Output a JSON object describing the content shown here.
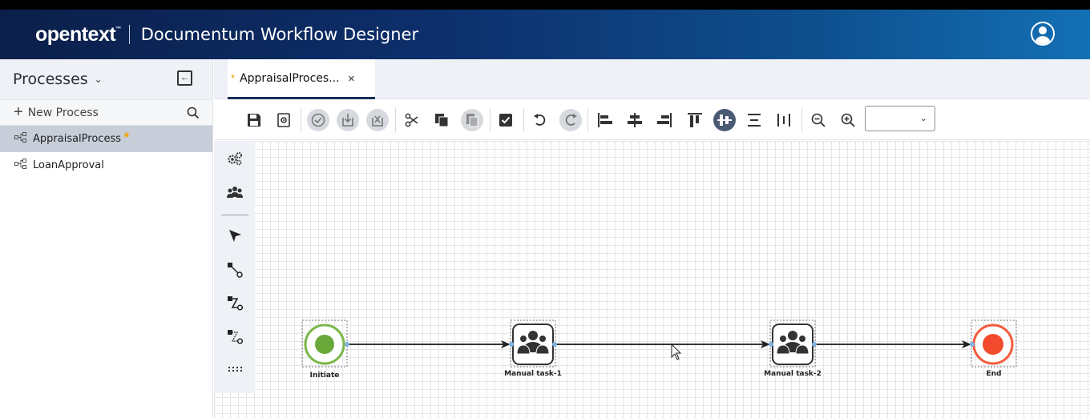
{
  "header": {
    "logo": "opentext",
    "logo_tm": "™",
    "app_title": "Documentum Workflow Designer"
  },
  "sidebar": {
    "title": "Processes",
    "new_process_label": "New Process",
    "items": [
      {
        "label": "AppraisalProcess",
        "active": true,
        "unsaved": true
      },
      {
        "label": "LoanApproval",
        "active": false,
        "unsaved": false
      }
    ]
  },
  "tabs": [
    {
      "label": "AppraisalProces...",
      "unsaved_marker": "*",
      "close": "×"
    }
  ],
  "toolbar": {
    "zoom_value": ""
  },
  "diagram": {
    "nodes": [
      {
        "id": "initiate",
        "label": "Initiate",
        "type": "start-event",
        "color": "#7ab648"
      },
      {
        "id": "manual1",
        "label": "Manual task-1",
        "type": "manual-task"
      },
      {
        "id": "manual2",
        "label": "Manual task-2",
        "type": "manual-task"
      },
      {
        "id": "end",
        "label": "End",
        "type": "end-event",
        "color": "#f25c3c"
      }
    ],
    "edges": [
      {
        "from": "initiate",
        "to": "manual1"
      },
      {
        "from": "manual1",
        "to": "manual2"
      },
      {
        "from": "manual2",
        "to": "end"
      }
    ]
  },
  "colors": {
    "header_start": "#0b1f4a",
    "header_end": "#1370b4",
    "sidebar_active": "#c7ced9",
    "star": "#f2a500"
  }
}
